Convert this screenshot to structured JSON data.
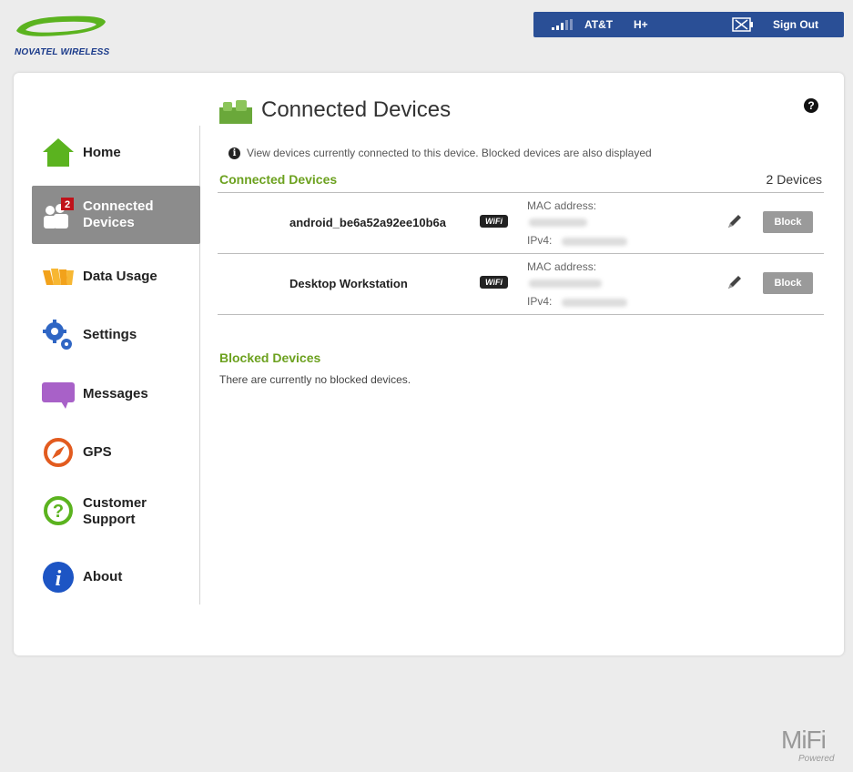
{
  "brand": {
    "logo_text": "NOVATEL WIRELESS",
    "footer_logo": "MiFi",
    "footer_sub": "Powered"
  },
  "statusbar": {
    "carrier": "AT&T",
    "network": "H+",
    "signout_label": "Sign Out"
  },
  "sidebar": {
    "items": [
      {
        "label": "Home",
        "icon": "home-icon"
      },
      {
        "label": "Connected Devices",
        "icon": "connected-devices-icon",
        "badge": "2",
        "active": true
      },
      {
        "label": "Data Usage",
        "icon": "data-usage-icon"
      },
      {
        "label": "Settings",
        "icon": "settings-icon"
      },
      {
        "label": "Messages",
        "icon": "messages-icon"
      },
      {
        "label": "GPS",
        "icon": "gps-icon"
      },
      {
        "label": "Customer Support",
        "icon": "customer-support-icon"
      },
      {
        "label": "About",
        "icon": "about-icon"
      }
    ]
  },
  "main": {
    "title": "Connected Devices",
    "info": "View devices currently connected to this device. Blocked devices are also displayed",
    "connected_section": "Connected Devices",
    "device_count": "2 Devices",
    "devices": [
      {
        "name": "android_be6a52a92ee10b6a",
        "connection": "WiFi",
        "mac_label": "MAC address:",
        "ipv4_label": "IPv4:",
        "block_label": "Block"
      },
      {
        "name": "Desktop Workstation",
        "connection": "WiFi",
        "mac_label": "MAC address:",
        "ipv4_label": "IPv4:",
        "block_label": "Block"
      }
    ],
    "blocked_section": "Blocked Devices",
    "blocked_empty": "There are currently no blocked devices."
  },
  "colors": {
    "accent_green": "#6ca11f",
    "statusbar_blue": "#2a4f96",
    "active_nav": "#8c8c8c"
  }
}
